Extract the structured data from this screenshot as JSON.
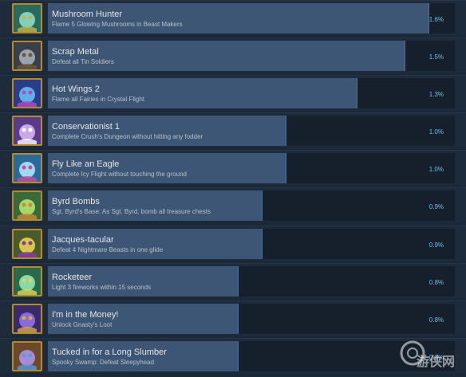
{
  "achievements": [
    {
      "title": "Mushroom Hunter",
      "description": "Flame 5 Glowing Mushrooms in Beast Makers",
      "percent": "1.6%",
      "rate": 1.6,
      "icon": "mushroom-hunter-icon",
      "colors": [
        "#2a6a5a",
        "#7fd0c0",
        "#c9b04a"
      ]
    },
    {
      "title": "Scrap Metal",
      "description": "Defeat all Tin Soldiers",
      "percent": "1.5%",
      "rate": 1.5,
      "icon": "scrap-metal-icon",
      "colors": [
        "#3a3f4a",
        "#9aa3b0",
        "#6b5b3a"
      ]
    },
    {
      "title": "Hot Wings 2",
      "description": "Flame all Fairies in Crystal Flight",
      "percent": "1.3%",
      "rate": 1.3,
      "icon": "hot-wings-icon",
      "colors": [
        "#2a3d8a",
        "#5fb0e8",
        "#b24ac9"
      ]
    },
    {
      "title": "Conservationist 1",
      "description": "Complete Crush's Dungeon without hitting any fodder",
      "percent": "1.0%",
      "rate": 1.0,
      "icon": "conservationist-icon",
      "colors": [
        "#5a3a8a",
        "#c9a8e8",
        "#ffffff"
      ]
    },
    {
      "title": "Fly Like an Eagle",
      "description": "Complete Icy Flight without touching the ground",
      "percent": "1.0%",
      "rate": 1.0,
      "icon": "fly-like-an-eagle-icon",
      "colors": [
        "#2a6a9a",
        "#9fd8f0",
        "#c94a9a"
      ]
    },
    {
      "title": "Byrd Bombs",
      "description": "Sgt. Byrd's Base: As Sgt. Byrd, bomb all treasure chests",
      "percent": "0.9%",
      "rate": 0.9,
      "icon": "byrd-bombs-icon",
      "colors": [
        "#3a6a3a",
        "#a8d86a",
        "#c98a3a"
      ]
    },
    {
      "title": "Jacques-tacular",
      "description": "Defeat 4 Nightmare Beasts in one glide",
      "percent": "0.9%",
      "rate": 0.9,
      "icon": "jacques-tacular-icon",
      "colors": [
        "#4a5a2a",
        "#d8c84a",
        "#8a3aa8"
      ]
    },
    {
      "title": "Rocketeer",
      "description": "Light 3 fireworks within 15 seconds",
      "percent": "0.8%",
      "rate": 0.8,
      "icon": "rocketeer-icon",
      "colors": [
        "#2a6a4a",
        "#8ad8a8",
        "#d8d85a"
      ]
    },
    {
      "title": "I'm in the Money!",
      "description": "Unlock Gnasty's Loot",
      "percent": "0.8%",
      "rate": 0.8,
      "icon": "in-the-money-icon",
      "colors": [
        "#3a2a6a",
        "#8a6ad8",
        "#d8a84a"
      ]
    },
    {
      "title": "Tucked in for a Long Slumber",
      "description": "Spooky Swamp: Defeat Sleepyhead",
      "percent": "0.8%",
      "rate": 0.8,
      "icon": "long-slumber-icon",
      "colors": [
        "#6a4a2a",
        "#a88ad8",
        "#5a9ad8"
      ]
    }
  ],
  "watermark": {
    "text": "游侠网"
  },
  "colors": {
    "background": "#1b2838",
    "row": "#1e2b3b",
    "bar_track": "#16202d",
    "bar_fill": "#3d5675",
    "percent_text": "#66c0f4",
    "icon_border": "#b58a2a"
  }
}
